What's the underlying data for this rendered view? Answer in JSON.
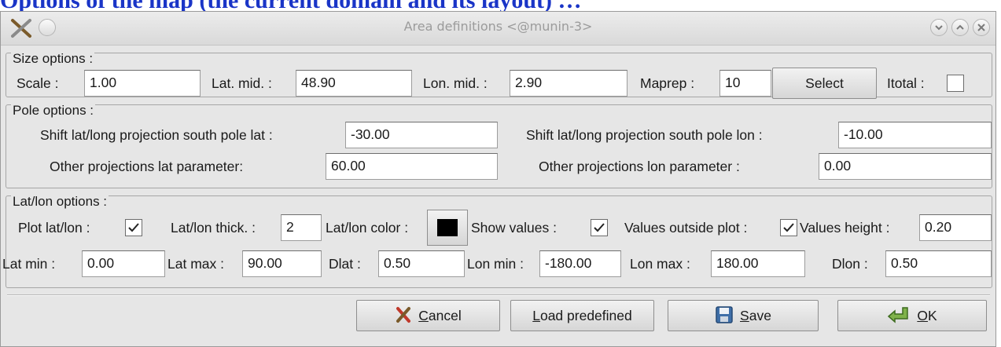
{
  "background_text": "Options of the map (the current domain and its layout) …",
  "window": {
    "title": "Area definitions <@munin-3>"
  },
  "colors": {
    "accent_bg_text": "#1a35c7",
    "window_bg": "#e6e6e6",
    "swatch": "#000000"
  },
  "size_options": {
    "legend": "Size options :",
    "scale_label": "Scale :",
    "scale_value": "1.00",
    "latmid_label": "Lat. mid. :",
    "latmid_value": "48.90",
    "lonmid_label": "Lon. mid. :",
    "lonmid_value": "2.90",
    "maprep_label": "Maprep :",
    "maprep_value": "10",
    "select_label": "Select",
    "itotal_label": "Itotal :",
    "itotal_checked": false
  },
  "pole_options": {
    "legend": "Pole options :",
    "shift_lat_label": "Shift lat/long projection south pole lat :",
    "shift_lat_value": "-30.00",
    "shift_lon_label": "Shift lat/long projection south pole lon :",
    "shift_lon_value": "-10.00",
    "other_lat_label": "Other projections lat parameter:",
    "other_lat_value": "60.00",
    "other_lon_label": "Other projections lon parameter :",
    "other_lon_value": "0.00"
  },
  "latlon_options": {
    "legend": "Lat/lon options :",
    "plot_label": "Plot lat/lon :",
    "plot_checked": true,
    "thick_label": "Lat/lon thick. :",
    "thick_value": "2",
    "color_label": "Lat/lon color :",
    "show_values_label": "Show values :",
    "show_values_checked": true,
    "outside_label": "Values outside plot :",
    "outside_checked": true,
    "height_label": "Values height :",
    "height_value": "0.20",
    "latmin_label": "Lat min :",
    "latmin_value": "0.00",
    "latmax_label": "Lat max :",
    "latmax_value": "90.00",
    "dlat_label": "Dlat :",
    "dlat_value": "0.50",
    "lonmin_label": "Lon min :",
    "lonmin_value": "-180.00",
    "lonmax_label": "Lon max :",
    "lonmax_value": "180.00",
    "dlon_label": "Dlon :",
    "dlon_value": "0.50"
  },
  "buttons": {
    "cancel_accel": "C",
    "cancel_rest": "ancel",
    "load_accel": "L",
    "load_rest": "oad predefined",
    "save_accel": "S",
    "save_rest": "ave",
    "ok_accel": "O",
    "ok_rest": "K"
  }
}
